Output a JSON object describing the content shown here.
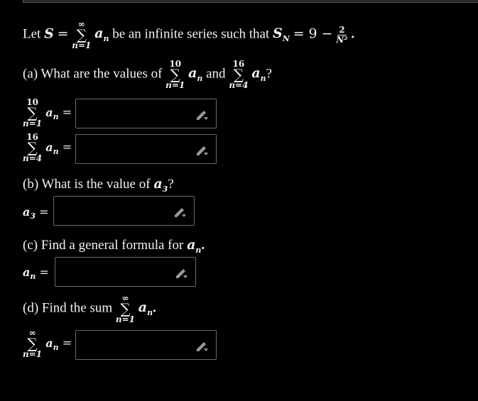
{
  "intro": {
    "lead": "Let",
    "S": "S",
    "eq": "=",
    "sum_upper": "∞",
    "sum_lower": "n=1",
    "term": "a",
    "term_sub": "n",
    "middle": "be an infinite series such that",
    "SN": "S",
    "SN_sub": "N",
    "eq2": "= 9 −",
    "frac_num": "2",
    "frac_den": "N²",
    "end": "."
  },
  "part_a": {
    "prompt": "(a) What are the values of",
    "sum1_upper": "10",
    "sum1_lower": "n=1",
    "and": "and",
    "sum2_upper": "16",
    "sum2_lower": "n=4",
    "end": "?",
    "row1": {
      "upper": "10",
      "lower": "n=1",
      "eq": "=",
      "value": ""
    },
    "row2": {
      "upper": "16",
      "lower": "n=4",
      "eq": "=",
      "value": ""
    }
  },
  "part_b": {
    "prompt": "(b) What is the value of",
    "var": "a",
    "var_sub": "3",
    "end": "?",
    "eq": "=",
    "value": ""
  },
  "part_c": {
    "prompt": "(c) Find a general formula for",
    "var": "a",
    "var_sub": "n",
    "end": ".",
    "eq": "=",
    "value": ""
  },
  "part_d": {
    "prompt": "(d) Find the sum",
    "sum_upper": "∞",
    "sum_lower": "n=1",
    "end": ".",
    "row": {
      "upper": "∞",
      "lower": "n=1",
      "eq": "=",
      "value": ""
    }
  },
  "icons": {
    "edit": "pencil-icon"
  }
}
